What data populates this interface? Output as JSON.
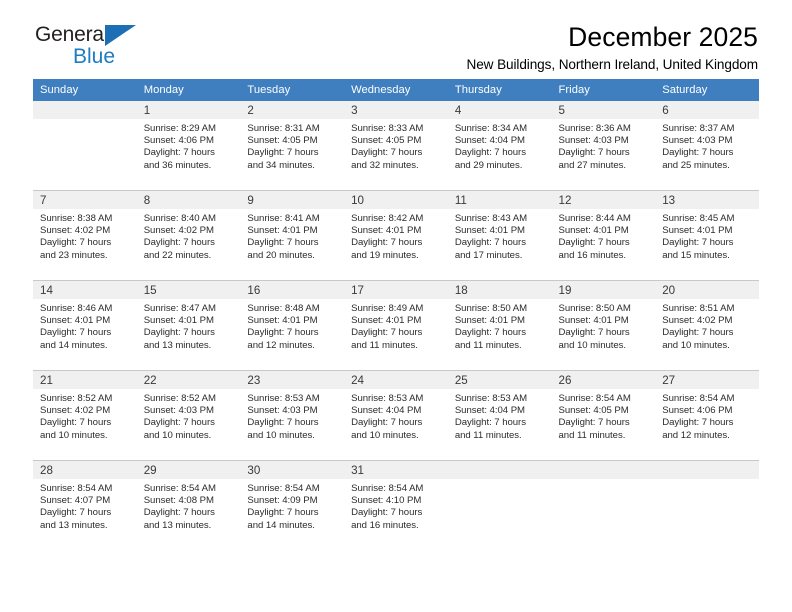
{
  "brand": {
    "name_part1": "General",
    "name_part2": "Blue",
    "triangle_icon": "triangle-icon",
    "accent_color": "#1d7cc4"
  },
  "header": {
    "title": "December 2025",
    "subtitle": "New Buildings, Northern Ireland, United Kingdom"
  },
  "calendar": {
    "header_bg": "#3f7ebf",
    "daynum_bg": "#f0f0f0",
    "weekday_headers": [
      "Sunday",
      "Monday",
      "Tuesday",
      "Wednesday",
      "Thursday",
      "Friday",
      "Saturday"
    ],
    "weeks": [
      [
        {
          "day": "",
          "sunrise": "",
          "sunset": "",
          "daylight_line1": "",
          "daylight_line2": "",
          "empty": true
        },
        {
          "day": "1",
          "sunrise": "Sunrise: 8:29 AM",
          "sunset": "Sunset: 4:06 PM",
          "daylight_line1": "Daylight: 7 hours",
          "daylight_line2": "and 36 minutes."
        },
        {
          "day": "2",
          "sunrise": "Sunrise: 8:31 AM",
          "sunset": "Sunset: 4:05 PM",
          "daylight_line1": "Daylight: 7 hours",
          "daylight_line2": "and 34 minutes."
        },
        {
          "day": "3",
          "sunrise": "Sunrise: 8:33 AM",
          "sunset": "Sunset: 4:05 PM",
          "daylight_line1": "Daylight: 7 hours",
          "daylight_line2": "and 32 minutes."
        },
        {
          "day": "4",
          "sunrise": "Sunrise: 8:34 AM",
          "sunset": "Sunset: 4:04 PM",
          "daylight_line1": "Daylight: 7 hours",
          "daylight_line2": "and 29 minutes."
        },
        {
          "day": "5",
          "sunrise": "Sunrise: 8:36 AM",
          "sunset": "Sunset: 4:03 PM",
          "daylight_line1": "Daylight: 7 hours",
          "daylight_line2": "and 27 minutes."
        },
        {
          "day": "6",
          "sunrise": "Sunrise: 8:37 AM",
          "sunset": "Sunset: 4:03 PM",
          "daylight_line1": "Daylight: 7 hours",
          "daylight_line2": "and 25 minutes."
        }
      ],
      [
        {
          "day": "7",
          "sunrise": "Sunrise: 8:38 AM",
          "sunset": "Sunset: 4:02 PM",
          "daylight_line1": "Daylight: 7 hours",
          "daylight_line2": "and 23 minutes."
        },
        {
          "day": "8",
          "sunrise": "Sunrise: 8:40 AM",
          "sunset": "Sunset: 4:02 PM",
          "daylight_line1": "Daylight: 7 hours",
          "daylight_line2": "and 22 minutes."
        },
        {
          "day": "9",
          "sunrise": "Sunrise: 8:41 AM",
          "sunset": "Sunset: 4:01 PM",
          "daylight_line1": "Daylight: 7 hours",
          "daylight_line2": "and 20 minutes."
        },
        {
          "day": "10",
          "sunrise": "Sunrise: 8:42 AM",
          "sunset": "Sunset: 4:01 PM",
          "daylight_line1": "Daylight: 7 hours",
          "daylight_line2": "and 19 minutes."
        },
        {
          "day": "11",
          "sunrise": "Sunrise: 8:43 AM",
          "sunset": "Sunset: 4:01 PM",
          "daylight_line1": "Daylight: 7 hours",
          "daylight_line2": "and 17 minutes."
        },
        {
          "day": "12",
          "sunrise": "Sunrise: 8:44 AM",
          "sunset": "Sunset: 4:01 PM",
          "daylight_line1": "Daylight: 7 hours",
          "daylight_line2": "and 16 minutes."
        },
        {
          "day": "13",
          "sunrise": "Sunrise: 8:45 AM",
          "sunset": "Sunset: 4:01 PM",
          "daylight_line1": "Daylight: 7 hours",
          "daylight_line2": "and 15 minutes."
        }
      ],
      [
        {
          "day": "14",
          "sunrise": "Sunrise: 8:46 AM",
          "sunset": "Sunset: 4:01 PM",
          "daylight_line1": "Daylight: 7 hours",
          "daylight_line2": "and 14 minutes."
        },
        {
          "day": "15",
          "sunrise": "Sunrise: 8:47 AM",
          "sunset": "Sunset: 4:01 PM",
          "daylight_line1": "Daylight: 7 hours",
          "daylight_line2": "and 13 minutes."
        },
        {
          "day": "16",
          "sunrise": "Sunrise: 8:48 AM",
          "sunset": "Sunset: 4:01 PM",
          "daylight_line1": "Daylight: 7 hours",
          "daylight_line2": "and 12 minutes."
        },
        {
          "day": "17",
          "sunrise": "Sunrise: 8:49 AM",
          "sunset": "Sunset: 4:01 PM",
          "daylight_line1": "Daylight: 7 hours",
          "daylight_line2": "and 11 minutes."
        },
        {
          "day": "18",
          "sunrise": "Sunrise: 8:50 AM",
          "sunset": "Sunset: 4:01 PM",
          "daylight_line1": "Daylight: 7 hours",
          "daylight_line2": "and 11 minutes."
        },
        {
          "day": "19",
          "sunrise": "Sunrise: 8:50 AM",
          "sunset": "Sunset: 4:01 PM",
          "daylight_line1": "Daylight: 7 hours",
          "daylight_line2": "and 10 minutes."
        },
        {
          "day": "20",
          "sunrise": "Sunrise: 8:51 AM",
          "sunset": "Sunset: 4:02 PM",
          "daylight_line1": "Daylight: 7 hours",
          "daylight_line2": "and 10 minutes."
        }
      ],
      [
        {
          "day": "21",
          "sunrise": "Sunrise: 8:52 AM",
          "sunset": "Sunset: 4:02 PM",
          "daylight_line1": "Daylight: 7 hours",
          "daylight_line2": "and 10 minutes."
        },
        {
          "day": "22",
          "sunrise": "Sunrise: 8:52 AM",
          "sunset": "Sunset: 4:03 PM",
          "daylight_line1": "Daylight: 7 hours",
          "daylight_line2": "and 10 minutes."
        },
        {
          "day": "23",
          "sunrise": "Sunrise: 8:53 AM",
          "sunset": "Sunset: 4:03 PM",
          "daylight_line1": "Daylight: 7 hours",
          "daylight_line2": "and 10 minutes."
        },
        {
          "day": "24",
          "sunrise": "Sunrise: 8:53 AM",
          "sunset": "Sunset: 4:04 PM",
          "daylight_line1": "Daylight: 7 hours",
          "daylight_line2": "and 10 minutes."
        },
        {
          "day": "25",
          "sunrise": "Sunrise: 8:53 AM",
          "sunset": "Sunset: 4:04 PM",
          "daylight_line1": "Daylight: 7 hours",
          "daylight_line2": "and 11 minutes."
        },
        {
          "day": "26",
          "sunrise": "Sunrise: 8:54 AM",
          "sunset": "Sunset: 4:05 PM",
          "daylight_line1": "Daylight: 7 hours",
          "daylight_line2": "and 11 minutes."
        },
        {
          "day": "27",
          "sunrise": "Sunrise: 8:54 AM",
          "sunset": "Sunset: 4:06 PM",
          "daylight_line1": "Daylight: 7 hours",
          "daylight_line2": "and 12 minutes."
        }
      ],
      [
        {
          "day": "28",
          "sunrise": "Sunrise: 8:54 AM",
          "sunset": "Sunset: 4:07 PM",
          "daylight_line1": "Daylight: 7 hours",
          "daylight_line2": "and 13 minutes."
        },
        {
          "day": "29",
          "sunrise": "Sunrise: 8:54 AM",
          "sunset": "Sunset: 4:08 PM",
          "daylight_line1": "Daylight: 7 hours",
          "daylight_line2": "and 13 minutes."
        },
        {
          "day": "30",
          "sunrise": "Sunrise: 8:54 AM",
          "sunset": "Sunset: 4:09 PM",
          "daylight_line1": "Daylight: 7 hours",
          "daylight_line2": "and 14 minutes."
        },
        {
          "day": "31",
          "sunrise": "Sunrise: 8:54 AM",
          "sunset": "Sunset: 4:10 PM",
          "daylight_line1": "Daylight: 7 hours",
          "daylight_line2": "and 16 minutes."
        },
        {
          "day": "",
          "sunrise": "",
          "sunset": "",
          "daylight_line1": "",
          "daylight_line2": "",
          "empty": true
        },
        {
          "day": "",
          "sunrise": "",
          "sunset": "",
          "daylight_line1": "",
          "daylight_line2": "",
          "empty": true
        },
        {
          "day": "",
          "sunrise": "",
          "sunset": "",
          "daylight_line1": "",
          "daylight_line2": "",
          "empty": true
        }
      ]
    ]
  }
}
